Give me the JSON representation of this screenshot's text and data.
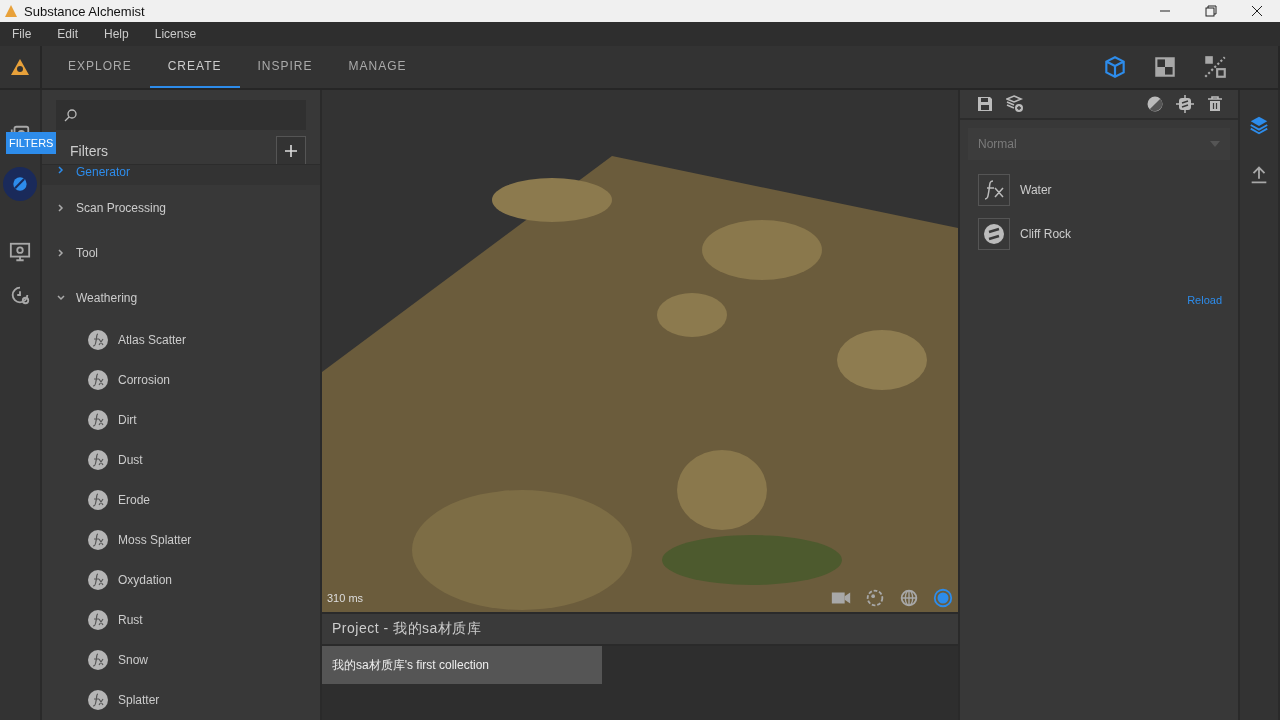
{
  "window": {
    "title": "Substance Alchemist"
  },
  "menu": [
    "File",
    "Edit",
    "Help",
    "License"
  ],
  "nav_tabs": [
    {
      "label": "EXPLORE",
      "selected": false
    },
    {
      "label": "CREATE",
      "selected": true
    },
    {
      "label": "INSPIRE",
      "selected": false
    },
    {
      "label": "MANAGE",
      "selected": false
    }
  ],
  "view_modes": [
    {
      "kind": "cube",
      "selected": true
    },
    {
      "kind": "checker",
      "selected": false
    },
    {
      "kind": "split",
      "selected": false
    }
  ],
  "left_rail": [
    {
      "kind": "library",
      "selected": false
    },
    {
      "kind": "filters",
      "selected": true
    },
    {
      "kind": "display",
      "selected": false
    },
    {
      "kind": "history",
      "selected": false
    }
  ],
  "tooltip": "FILTERS",
  "filters_panel": {
    "title": "Filters",
    "categories": [
      {
        "label": "Generator",
        "selected": true,
        "expanded": false
      },
      {
        "label": "Scan Processing",
        "selected": false,
        "expanded": false
      },
      {
        "label": "Tool",
        "selected": false,
        "expanded": false
      },
      {
        "label": "Weathering",
        "selected": false,
        "expanded": true,
        "children": [
          {
            "label": "Atlas Scatter"
          },
          {
            "label": "Corrosion"
          },
          {
            "label": "Dirt"
          },
          {
            "label": "Dust"
          },
          {
            "label": "Erode"
          },
          {
            "label": "Moss Splatter"
          },
          {
            "label": "Oxydation"
          },
          {
            "label": "Rust"
          },
          {
            "label": "Snow"
          },
          {
            "label": "Splatter"
          }
        ]
      }
    ]
  },
  "viewport": {
    "render_time": "310 ms",
    "tools": [
      {
        "kind": "camera",
        "selected": false
      },
      {
        "kind": "light",
        "selected": false
      },
      {
        "kind": "environment",
        "selected": false
      },
      {
        "kind": "sphere",
        "selected": true
      }
    ]
  },
  "project": {
    "title": "Project - 我的sa材质库",
    "collections": [
      {
        "label": "我的sa材质库's first collection",
        "selected": true
      }
    ]
  },
  "layers_panel": {
    "blend_mode": {
      "value": "Normal",
      "disabled": true
    },
    "layers": [
      {
        "name": "Water",
        "kind": "filter"
      },
      {
        "name": "Cliff Rock",
        "kind": "substance"
      }
    ],
    "reload": "Reload"
  },
  "right_rail": [
    {
      "kind": "layers",
      "selected": true
    },
    {
      "kind": "export",
      "selected": false
    }
  ]
}
